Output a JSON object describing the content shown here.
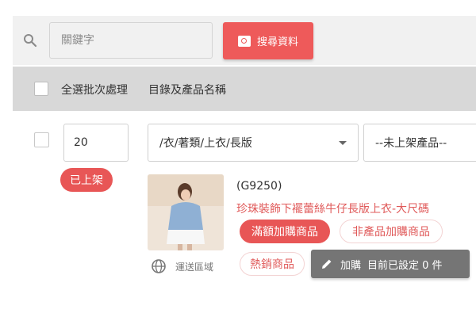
{
  "search": {
    "placeholder": "關鍵字",
    "button_label": "搜尋資料"
  },
  "header": {
    "select_all_label": "全選批次處理",
    "column_label": "目錄及產品名稱"
  },
  "product": {
    "quantity": "20",
    "status": "已上架",
    "category": "/衣/著類/上衣/長版",
    "listing_filter": "--未上架產品--",
    "sku": "(G9250)",
    "name": "珍珠裝飾下襬蕾絲牛仔長版上衣-大尺碼",
    "region_label": "運送區域",
    "tags": [
      "滿額加購商品",
      "非產品加購商品",
      "熱銷商品"
    ],
    "add_label": "加購",
    "add_status": "目前已設定 0 件"
  },
  "colors": {
    "accent": "#ee5a5a",
    "header_bg": "#d8d8d8",
    "add_button": "#757575"
  }
}
